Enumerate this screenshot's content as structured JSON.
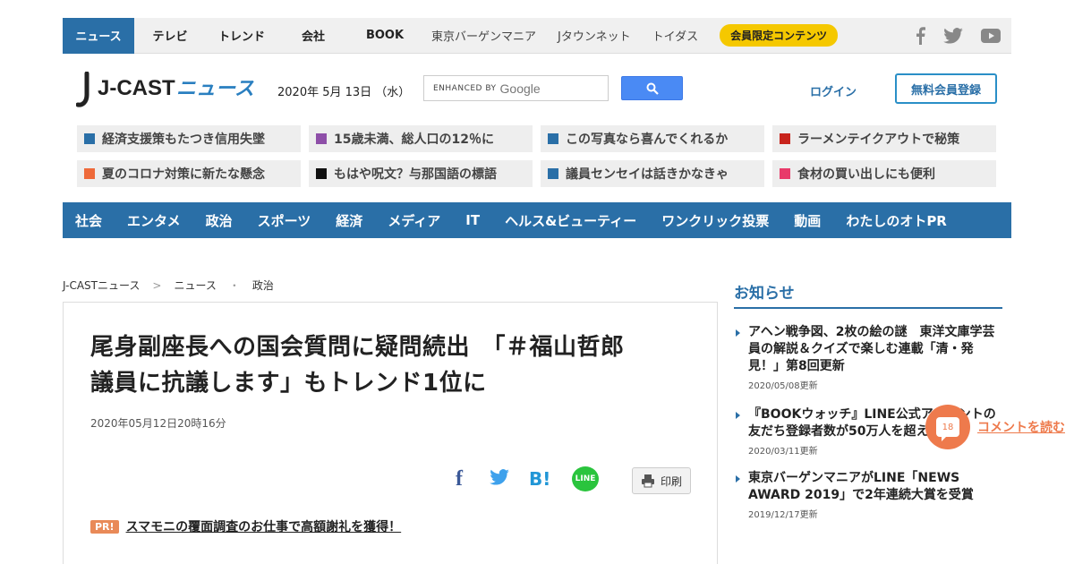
{
  "topnav": {
    "items": [
      "ニュース",
      "テレビ",
      "トレンド",
      "会社",
      "BOOK"
    ],
    "partners": [
      "東京バーゲンマニア",
      "Jタウンネット",
      "トイダス"
    ],
    "member_label": "会員限定コンテンツ"
  },
  "header": {
    "logo_main": "J-CAST",
    "logo_sub": "ニュース",
    "date_text": "2020年 5月 13日 （水）",
    "search_enhanced": "ENHANCED BY",
    "search_google": "Google",
    "login_label": "ログイン",
    "register_label": "無料会員登録"
  },
  "ticker": [
    {
      "text": "経済支援策もたつき信用失墜",
      "color": "#2a6fa7"
    },
    {
      "text": "15歳未満、総人口の12％に",
      "color": "#8e4fa8"
    },
    {
      "text": "この写真なら喜んでくれるか",
      "color": "#2a6fa7"
    },
    {
      "text": "ラーメンテイクアウトで秘策",
      "color": "#c8241c"
    },
    {
      "text": "夏のコロナ対策に新たな懸念",
      "color": "#ee6a3a"
    },
    {
      "text": "もはや呪文？与那国語の標語",
      "color": "#111111"
    },
    {
      "text": "議員センセイは話きかなきゃ",
      "color": "#2a6fa7"
    },
    {
      "text": "食材の買い出しにも便利",
      "color": "#e83a6a"
    }
  ],
  "categories": [
    "社会",
    "エンタメ",
    "政治",
    "スポーツ",
    "経済",
    "メディア",
    "IT",
    "ヘルス&ビューティー",
    "ワンクリック投票",
    "動画",
    "わたしのオトPR"
  ],
  "breadcrumb": {
    "home": "J-CASTニュース",
    "sep1": ">",
    "section": "ニュース",
    "sep2": "・",
    "category": "政治"
  },
  "article": {
    "headline_line1": "尾身副座長への国会質問に疑問続出　「＃福山哲郎",
    "headline_line2": "議員に抗議します」もトレンド1位に",
    "published": "2020年05月12日20時16分",
    "share_fb": "f",
    "share_hatena": "B!",
    "share_line": "LINE",
    "print_label": "印刷",
    "pr_badge": "PR!",
    "pr_link": "スマモニの覆面調査のお仕事で高額謝礼を獲得！"
  },
  "sidebar": {
    "title": "お知らせ",
    "notices": [
      {
        "title": "アヘン戦争図、2枚の絵の謎　東洋文庫学芸員の解説＆クイズで楽しむ連載「清・発見！」第8回更新",
        "date": "2020/05/08更新"
      },
      {
        "title": "『BOOKウォッチ』LINE公式アカウントの友だち登録者数が50万人を超えました",
        "date": "2020/03/11更新"
      },
      {
        "title": "東京バーゲンマニアがLINE「NEWS AWARD 2019」で2年連続大賞を受賞",
        "date": "2019/12/17更新"
      }
    ]
  },
  "comments": {
    "count": "18",
    "link_label": "コメントを読む"
  }
}
